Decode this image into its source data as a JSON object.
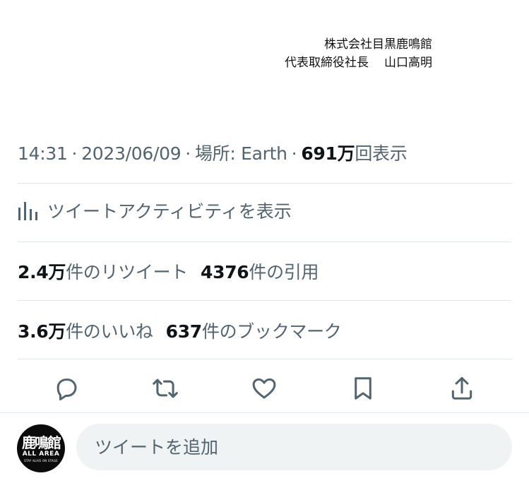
{
  "signature": {
    "company": "株式会社目黒鹿鳴館",
    "title": "代表取締役社長",
    "name": "山口高明"
  },
  "meta": {
    "time": "14:31",
    "date": "2023/06/09",
    "location_label": "場所: Earth",
    "views_value": "691万",
    "views_label": "回表示",
    "separator": "·"
  },
  "activity": {
    "label": "ツイートアクティビティを表示",
    "icon": "bar-chart-icon"
  },
  "stats": {
    "retweets_value": "2.4万",
    "retweets_label": "件のリツイート",
    "quotes_value": "4376",
    "quotes_label": "件の引用",
    "likes_value": "3.6万",
    "likes_label": "件のいいね",
    "bookmarks_value": "637",
    "bookmarks_label": "件のブックマーク"
  },
  "actions": [
    "reply-icon",
    "retweet-icon",
    "like-icon",
    "bookmark-icon",
    "share-icon"
  ],
  "avatar": {
    "line1": "鹿鳴館",
    "line2": "ALL AREA",
    "line3": "STAY ALIVE ON STAGE"
  },
  "reply": {
    "placeholder": "ツイートを追加"
  },
  "colors": {
    "text": "#0f1419",
    "secondary": "#536471",
    "divider": "#e1e6ea",
    "input_bg": "#eff3f4"
  }
}
